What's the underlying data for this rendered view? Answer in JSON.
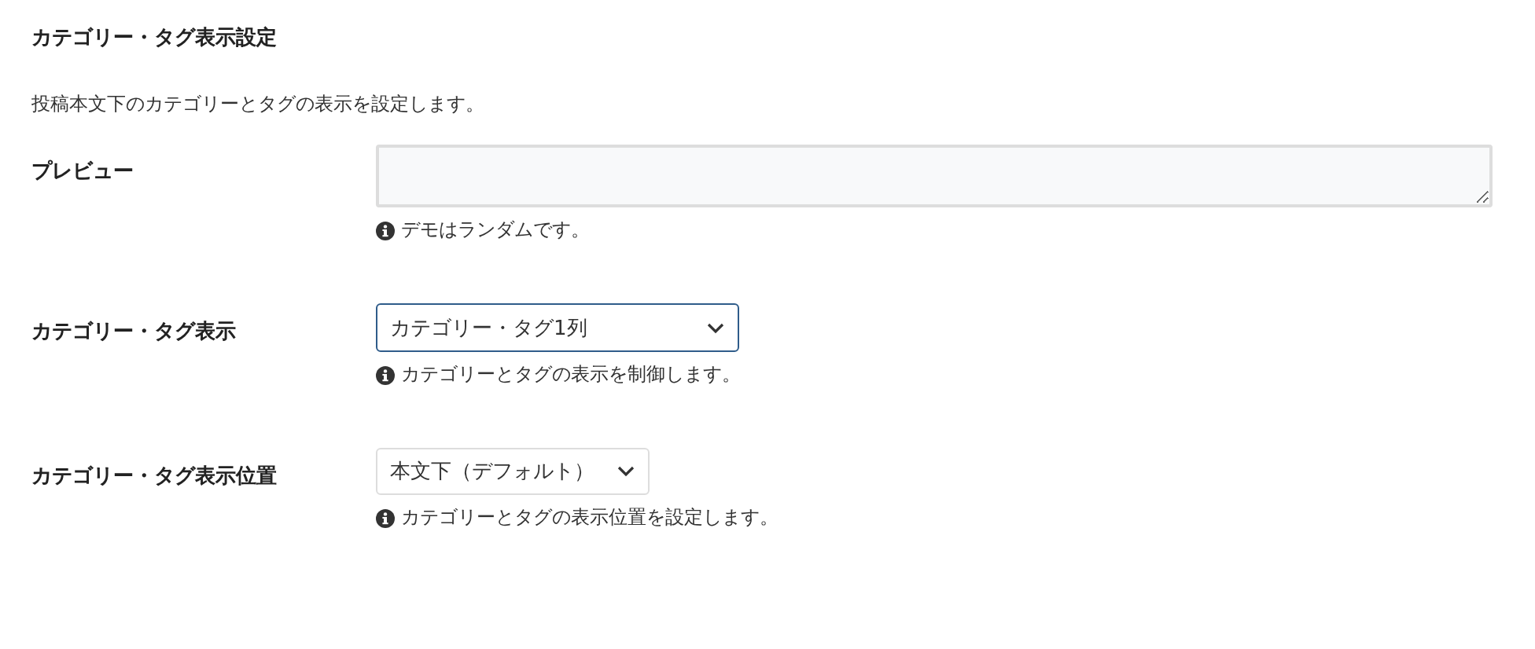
{
  "section": {
    "title": "カテゴリー・タグ表示設定",
    "description": "投稿本文下のカテゴリーとタグの表示を設定します。"
  },
  "settings": [
    {
      "kind": "textarea",
      "label": "プレビュー",
      "hint": "デモはランダムです。"
    },
    {
      "kind": "select",
      "label": "カテゴリー・タグ表示",
      "value": "カテゴリー・タグ1列",
      "focused": true,
      "hint": "カテゴリーとタグの表示を制御します。"
    },
    {
      "kind": "select",
      "label": "カテゴリー・タグ表示位置",
      "value": "本文下（デフォルト）",
      "focused": false,
      "hint": "カテゴリーとタグの表示位置を設定します。"
    }
  ]
}
